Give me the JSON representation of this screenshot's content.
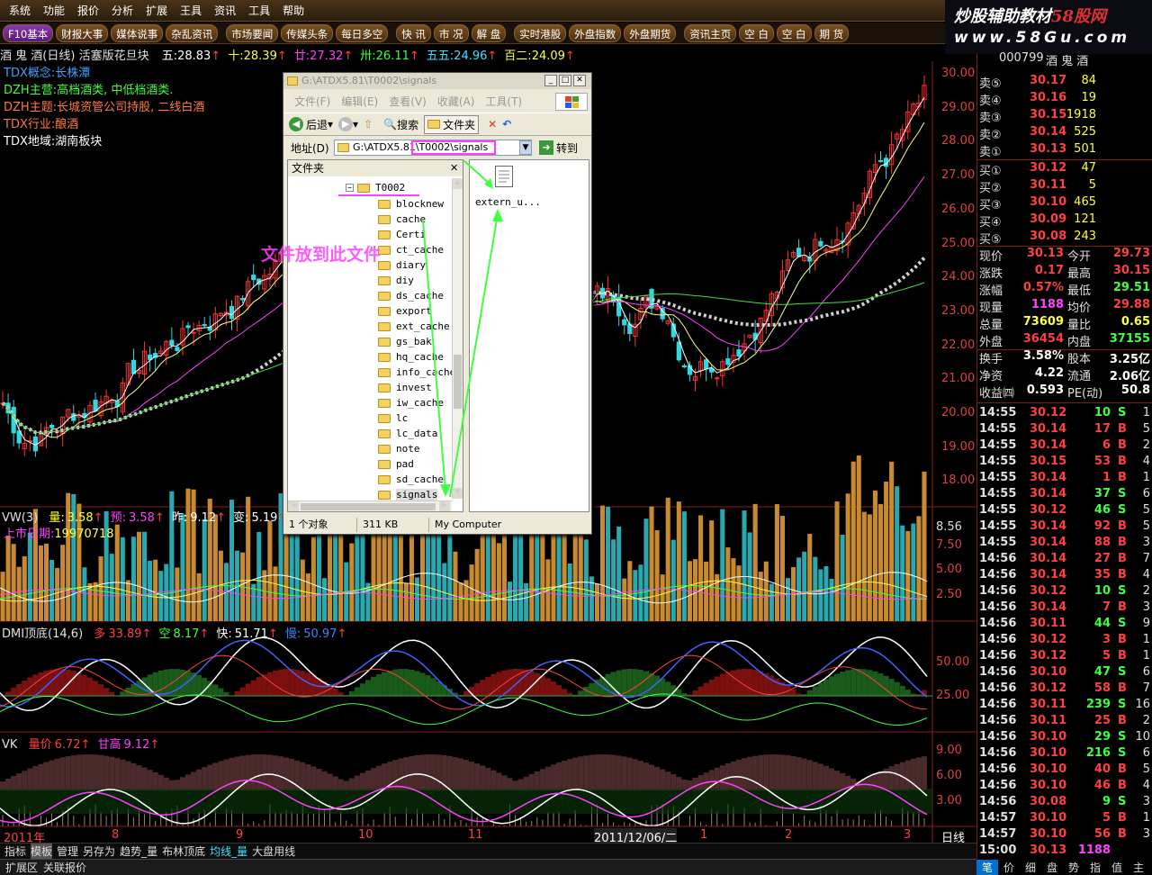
{
  "menubar": {
    "items": [
      "系统",
      "功能",
      "报价",
      "分析",
      "扩展",
      "王具",
      "资讯",
      "工具",
      "帮助"
    ]
  },
  "logo": {
    "line1": "炒股辅助教材",
    "line1_accent": "58股网",
    "line2": "www.58Gu.com"
  },
  "toolbar": {
    "items": [
      "F10基本",
      "财报大事",
      "媒体说事",
      "杂乱资讯",
      "市场要闻",
      "传媒头条",
      "每日多空",
      "快 讯",
      "市 况",
      "解 盘",
      "实时港股",
      "外盘指数",
      "外盘期货",
      "资讯主页",
      "空 白",
      "空 白",
      "期 货"
    ]
  },
  "stock": {
    "title": "酒 鬼 酒(日线)",
    "subtitle": "活塞版花旦块",
    "ma": [
      {
        "label": "五:",
        "value": "28.83"
      },
      {
        "label": "十:",
        "value": "28.39"
      },
      {
        "label": "廿:",
        "value": "27.32"
      },
      {
        "label": "卅:",
        "value": "26.11"
      },
      {
        "label": "五五:",
        "value": "24.96"
      },
      {
        "label": "百二:",
        "value": "24.09"
      }
    ]
  },
  "tags": [
    {
      "label": "TDX概念:",
      "value": "长株潭"
    },
    {
      "label": "DZH主营:",
      "value": "高档酒类, 中低档酒类."
    },
    {
      "label": "DZH主题:",
      "value": "长城资管公司持股, 二线白酒"
    },
    {
      "label": "TDX行业:",
      "value": "酿酒"
    },
    {
      "label": "TDX地域:",
      "value": "湖南板块"
    }
  ],
  "price_axis": [
    "30.00",
    "29.00",
    "28.00",
    "27.00",
    "26.00",
    "25.00",
    "24.00",
    "23.00",
    "22.00",
    "21.00",
    "20.00",
    "19.00",
    "18.00"
  ],
  "vol_panel": {
    "title": "VW(3)",
    "items": [
      {
        "label": "量:",
        "value": "3.58"
      },
      {
        "label": "预:",
        "value": "3.58"
      },
      {
        "label": "昨:",
        "value": "9.12"
      },
      {
        "label": "变:",
        "value": "5.19"
      }
    ],
    "listing_label": "上市日期:",
    "listing_value": "19970718",
    "axis": [
      "8.56",
      "7.50",
      "5.00",
      "2.50"
    ]
  },
  "dmi_panel": {
    "title": "DMI顶底(14,6)",
    "items": [
      {
        "label": "多",
        "value": "33.89"
      },
      {
        "label": "空",
        "value": "8.17"
      },
      {
        "label": "快:",
        "value": "51.71"
      },
      {
        "label": "慢:",
        "value": "50.97"
      }
    ],
    "axis": [
      "50.00",
      "25.00"
    ]
  },
  "vk_panel": {
    "title": "VK",
    "items": [
      {
        "label": "量价",
        "value": "6.72"
      },
      {
        "label": "甘高",
        "value": "9.12"
      }
    ],
    "axis": [
      "9.00",
      "6.00",
      "3.00"
    ]
  },
  "date_axis": {
    "year": "2011年",
    "marks": [
      "8",
      "9",
      "10",
      "11",
      "12",
      "2011/12/06/二",
      "1",
      "2",
      "3"
    ],
    "mode": "日线"
  },
  "panel": {
    "code": "000799",
    "name": "酒 鬼 酒",
    "sell": [
      {
        "label": "卖⑤",
        "price": "30.17",
        "vol": "84"
      },
      {
        "label": "卖④",
        "price": "30.16",
        "vol": "19"
      },
      {
        "label": "卖③",
        "price": "30.15",
        "vol": "1918"
      },
      {
        "label": "卖②",
        "price": "30.14",
        "vol": "525"
      },
      {
        "label": "卖①",
        "price": "30.13",
        "vol": "501"
      }
    ],
    "buy": [
      {
        "label": "买①",
        "price": "30.12",
        "vol": "47"
      },
      {
        "label": "买②",
        "price": "30.11",
        "vol": "5"
      },
      {
        "label": "买③",
        "price": "30.10",
        "vol": "465"
      },
      {
        "label": "买④",
        "price": "30.09",
        "vol": "121"
      },
      {
        "label": "买⑤",
        "price": "30.08",
        "vol": "243"
      }
    ],
    "stats": [
      [
        "现价",
        "30.13",
        "今开",
        "29.73"
      ],
      [
        "涨跌",
        "0.17",
        "最高",
        "30.15"
      ],
      [
        "涨幅",
        "0.57%",
        "最低",
        "29.51"
      ],
      [
        "现量",
        "1188",
        "均价",
        "29.88"
      ],
      [
        "总量",
        "73609",
        "量比",
        "0.65"
      ],
      [
        "外盘",
        "36454",
        "内盘",
        "37155"
      ],
      [
        "换手",
        "3.58%",
        "股本",
        "3.25亿"
      ],
      [
        "净资",
        "4.22",
        "流通",
        "2.06亿"
      ],
      [
        "收益㈣",
        "0.593",
        "PE(动)",
        "50.8"
      ]
    ],
    "ticks": [
      [
        "14:55",
        "30.12",
        "10",
        "S",
        "1"
      ],
      [
        "14:55",
        "30.14",
        "17",
        "B",
        "5"
      ],
      [
        "14:55",
        "30.14",
        "6",
        "B",
        "2"
      ],
      [
        "14:55",
        "30.15",
        "53",
        "B",
        "4"
      ],
      [
        "14:55",
        "30.14",
        "1",
        "B",
        "1"
      ],
      [
        "14:55",
        "30.14",
        "37",
        "S",
        "6"
      ],
      [
        "14:55",
        "30.12",
        "46",
        "S",
        "5"
      ],
      [
        "14:55",
        "30.14",
        "92",
        "B",
        "5"
      ],
      [
        "14:55",
        "30.14",
        "88",
        "B",
        "3"
      ],
      [
        "14:56",
        "30.14",
        "27",
        "B",
        "7"
      ],
      [
        "14:56",
        "30.14",
        "35",
        "B",
        "4"
      ],
      [
        "14:56",
        "30.12",
        "10",
        "S",
        "2"
      ],
      [
        "14:56",
        "30.14",
        "7",
        "B",
        "3"
      ],
      [
        "14:56",
        "30.11",
        "44",
        "S",
        "9"
      ],
      [
        "14:56",
        "30.12",
        "3",
        "B",
        "1"
      ],
      [
        "14:56",
        "30.12",
        "5",
        "B",
        "1"
      ],
      [
        "14:56",
        "30.10",
        "47",
        "S",
        "6"
      ],
      [
        "14:56",
        "30.12",
        "58",
        "B",
        "7"
      ],
      [
        "14:56",
        "30.11",
        "239",
        "S",
        "16"
      ],
      [
        "14:56",
        "30.11",
        "25",
        "B",
        "2"
      ],
      [
        "14:56",
        "30.10",
        "29",
        "S",
        "10"
      ],
      [
        "14:56",
        "30.10",
        "216",
        "S",
        "6"
      ],
      [
        "14:56",
        "30.10",
        "40",
        "B",
        "5"
      ],
      [
        "14:56",
        "30.10",
        "46",
        "B",
        "4"
      ],
      [
        "14:56",
        "30.08",
        "9",
        "S",
        "3"
      ],
      [
        "14:57",
        "30.10",
        "5",
        "B",
        "1"
      ],
      [
        "14:57",
        "30.10",
        "56",
        "B",
        "3"
      ],
      [
        "15:00",
        "30.13",
        "1188",
        "",
        ""
      ]
    ]
  },
  "statusbar": {
    "items": [
      "指标",
      "模板",
      "管理",
      "另存为",
      "趋势_量",
      "布林顶底",
      "均线_量",
      "大盘用线"
    ]
  },
  "bottom": {
    "items": [
      "扩展区",
      "关联报价"
    ],
    "right_tabs": [
      "笔",
      "价",
      "细",
      "盘",
      "势",
      "指",
      "值",
      "主"
    ]
  },
  "explorer": {
    "title": "G:\\ATDX5.81\\T0002\\signals",
    "menu": [
      "文件(F)",
      "编辑(E)",
      "查看(V)",
      "收藏(A)",
      "工具(T)"
    ],
    "toolbar": {
      "back": "后退",
      "search": "搜索",
      "folders": "文件夹"
    },
    "address_label": "地址(D)",
    "address": "G:\\ATDX5.81\\T0002\\signals",
    "go": "转到",
    "folder_header": "文件夹",
    "root": "T0002",
    "folders": [
      "blocknew",
      "cache",
      "Certi",
      "ct_cache",
      "diary",
      "diy",
      "ds_cache",
      "export",
      "ext_cache",
      "gs_bak",
      "hq_cache",
      "info_cache",
      "invest",
      "iw_cache",
      "lc",
      "lc_data",
      "note",
      "pad",
      "sd_cache",
      "signals"
    ],
    "file": "extern_u...",
    "status": [
      "1 个对象",
      "311 KB",
      "My Computer"
    ]
  },
  "annotation": "文件放到此文件"
}
